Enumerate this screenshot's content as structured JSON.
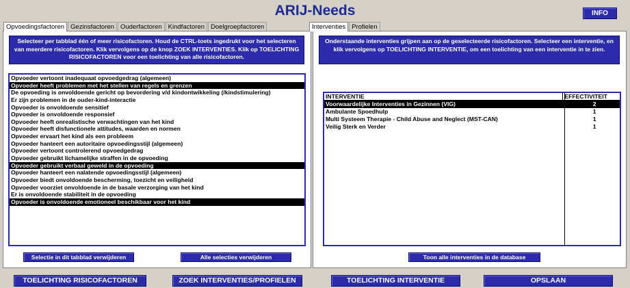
{
  "app": {
    "title": "ARIJ-Needs",
    "info_label": "INFO"
  },
  "left_tabs": [
    "Opvoedingsfactoren",
    "Gezinsfactoren",
    "Ouderfactoren",
    "Kindfactoren",
    "Doelgroepfactoren"
  ],
  "right_tabs": [
    "Interventies",
    "Profielen"
  ],
  "left_instruction": "Selecteer per tabblad één of meer risicofactoren. Houd de CTRL-toets ingedrukt voor het selecteren van meerdere risicofactoren. Klik vervolgens op de knop ZOEK INTERVENTIES. Klik op TOELICHTING RISICOFACTOREN voor een toelichting van alle risicofactoren.",
  "right_instruction": "Onderstaande interventies grijpen aan op de geselecteerde risicofactoren. Selecteer een interventie, en klik vervolgens op TOELICHTING INTERVENTIE, om een toelichting van een interventie in te zien.",
  "risk_factors": [
    {
      "label": "Opvoeder vertoont inadequaat opvoedgedrag (algemeen)",
      "selected": false
    },
    {
      "label": "Opvoeder heeft problemen met het stellen van regels en grenzen",
      "selected": true
    },
    {
      "label": "De opvoeding is onvoldoende gericht op bevordering v/d kindontwikkeling (/kindstimulering)",
      "selected": false
    },
    {
      "label": "Er zijn problemen in de ouder-kind-interactie",
      "selected": false
    },
    {
      "label": "Opvoeder is onvoldoende sensitief",
      "selected": false
    },
    {
      "label": "Opvoeder is onvoldoende responsief",
      "selected": false
    },
    {
      "label": "Opvoeder heeft onrealistische verwachtingen van het kind",
      "selected": false
    },
    {
      "label": "Opvoeder heeft disfunctionele attitudes, waarden en normen",
      "selected": false
    },
    {
      "label": "Opvoeder ervaart het kind als een probleem",
      "selected": false
    },
    {
      "label": "Opvoeder hanteert een autoritaire opvoedingsstijl (algemeen)",
      "selected": false
    },
    {
      "label": "Opvoeder vertoont controlerend opvoedgedrag",
      "selected": false
    },
    {
      "label": "Opvoeder gebruikt lichamelijke straffen in de opvoeding",
      "selected": false
    },
    {
      "label": "Opvoeder gebruikt verbaal geweld in de opvoeding",
      "selected": true
    },
    {
      "label": "Opvoeder hanteert een nalatende opvoedingsstijl (algemeen)",
      "selected": false
    },
    {
      "label": "Opvoeder biedt onvoldoende bescherming, toezicht en veiligheid",
      "selected": false
    },
    {
      "label": "Opvoeder voorziet onvoldoende in de basale verzorging van het kind",
      "selected": false
    },
    {
      "label": "Er is onvoldoende stabiliteit in de opvoeding",
      "selected": false
    },
    {
      "label": "Opvoeder is onvoldoende emotioneel beschikbaar voor het kind",
      "selected": true
    }
  ],
  "interventions": {
    "headers": {
      "name": "INTERVENTIE",
      "effect": "EFFECTIVITEIT"
    },
    "rows": [
      {
        "name": "Voorwaardelijke Interventies in Gezinnen (VIG)",
        "effect": "2",
        "selected": true
      },
      {
        "name": "Ambulante Spoedhulp",
        "effect": "1",
        "selected": false
      },
      {
        "name": "Multi Systeem Therapie - Child Abuse and Neglect (MST-CAN)",
        "effect": "1",
        "selected": false
      },
      {
        "name": "Veilig Sterk en Verder",
        "effect": "1",
        "selected": false
      }
    ]
  },
  "buttons": {
    "clear_tab": "Selectie in dit tabblad verwijderen",
    "clear_all": "Alle selecties verwijderen",
    "show_all": "Toon alle interventies in de database",
    "explain_risk": "TOELICHTING RISICOFACTOREN",
    "search": "ZOEK INTERVENTIES/PROFIELEN",
    "explain_intervention": "TOELICHTING INTERVENTIE",
    "save": "OPSLAAN"
  },
  "colors": {
    "accent": "#2b2bab",
    "title": "#1e2a8e",
    "background": "#d4d0c8"
  }
}
